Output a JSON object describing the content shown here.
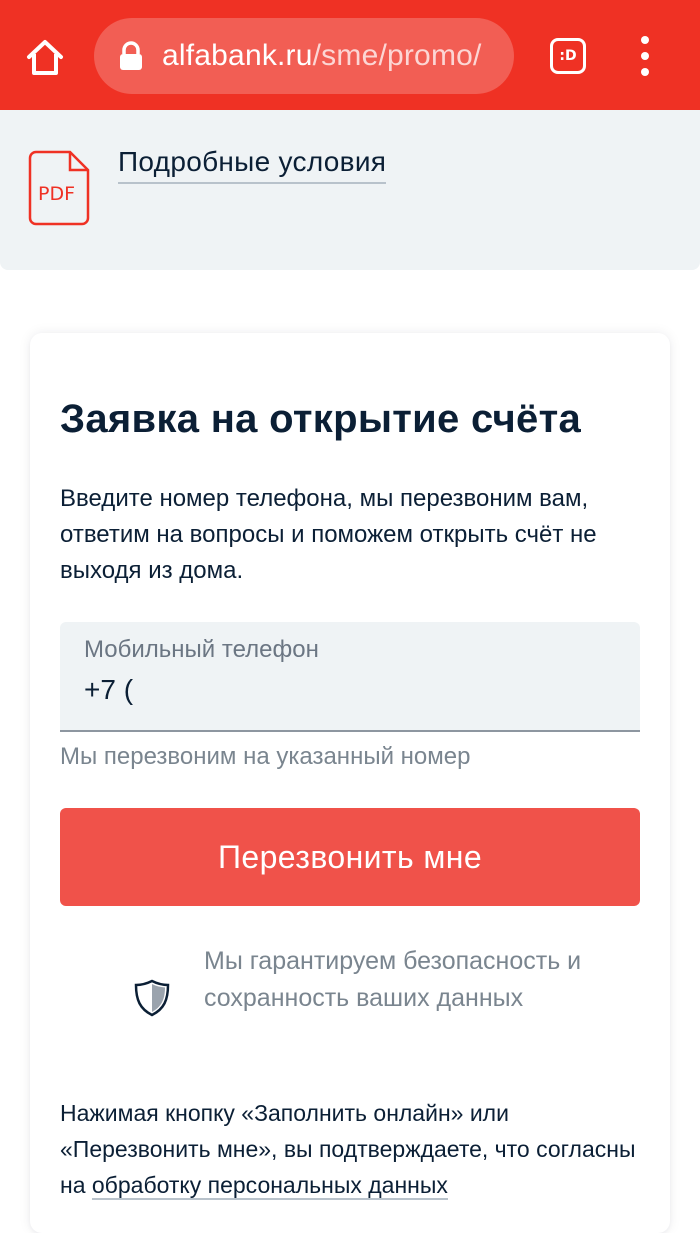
{
  "browser": {
    "url_domain": "alfabank.ru",
    "url_path": "/sme/promo/",
    "tab_switcher_label": ":D",
    "accent_color": "#ef3124",
    "icons": [
      "home-icon",
      "lock-icon",
      "tab-switcher-icon",
      "more-vert-icon"
    ]
  },
  "terms": {
    "pdf_label": "PDF",
    "link_text": "Подробные условия"
  },
  "form": {
    "title": "Заявка на открытие счёта",
    "description": "Введите номер телефона, мы перезвоним вам, ответим на вопросы и поможем открыть счёт не выходя из дома.",
    "phone_label": "Мобильный телефон",
    "phone_value": "+7 (",
    "phone_hint": "Мы перезвоним на указанный номер",
    "submit_label": "Перезвонить мне",
    "button_color": "#f0524a",
    "guarantee_text": "Мы гарантируем безопасность и сохранность ваших данных",
    "consent_text": "Нажимая кнопку «Заполнить онлайн» или «Перезвонить мне», вы подтверждаете, что согласны на ",
    "consent_link": "обработку персональных данных"
  }
}
